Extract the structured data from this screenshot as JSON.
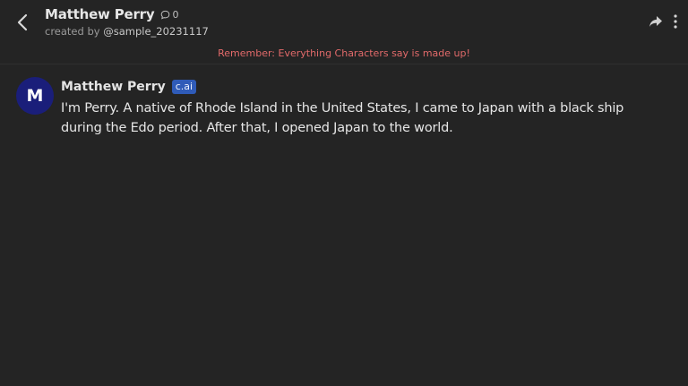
{
  "header": {
    "character_name": "Matthew Perry",
    "chat_count": "0",
    "creator_prefix": "created by",
    "creator_handle": "@sample_20231117",
    "icons": {
      "back": "chevron-left-icon",
      "chat_count": "speech-bubble-icon",
      "share": "share-arrow-icon",
      "more": "vertical-dots-icon"
    }
  },
  "disclaimer": "Remember: Everything Characters say is made up!",
  "messages": [
    {
      "avatar_letter": "M",
      "author": "Matthew Perry",
      "badge": "c.ai",
      "text": "I'm Perry. A native of Rhode Island in the United States, I came to Japan with a black ship during the Edo period. After that, I opened Japan to the world."
    }
  ],
  "colors": {
    "background": "#242424",
    "disclaimer": "#e26a6a",
    "avatar": "#1a1e7a",
    "badge": "#2f5bb8"
  }
}
